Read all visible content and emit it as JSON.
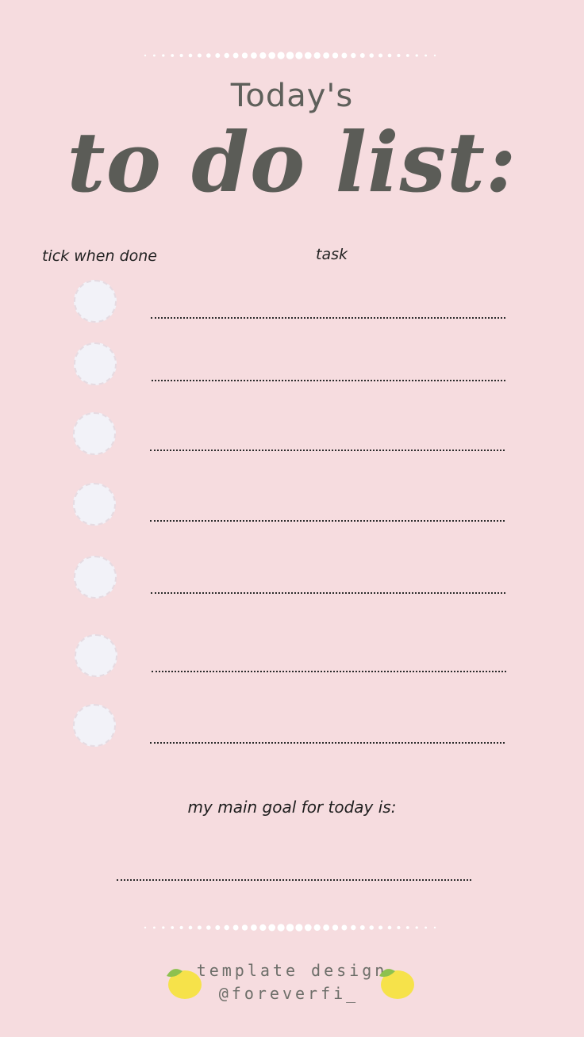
{
  "header": {
    "title_small": "Today's",
    "title_big": "to do list:"
  },
  "columns": {
    "tick_label": "tick when done",
    "task_label": "task"
  },
  "tasks": [
    {
      "done": false,
      "text": ""
    },
    {
      "done": false,
      "text": ""
    },
    {
      "done": false,
      "text": ""
    },
    {
      "done": false,
      "text": ""
    },
    {
      "done": false,
      "text": ""
    },
    {
      "done": false,
      "text": ""
    },
    {
      "done": false,
      "text": ""
    }
  ],
  "goal": {
    "label": "my main goal for today is:",
    "text": ""
  },
  "footer": {
    "line1": "template design",
    "line2": "@foreverfi_"
  },
  "icons": {
    "lemon_left": "lemon-icon",
    "lemon_right": "lemon-icon"
  },
  "colors": {
    "background": "#f6dcdf",
    "title": "#5b5c57",
    "circle": "#f2f2f8",
    "dots": "#ffffff",
    "lemon": "#f6e24a",
    "leaf": "#8dc14f"
  }
}
